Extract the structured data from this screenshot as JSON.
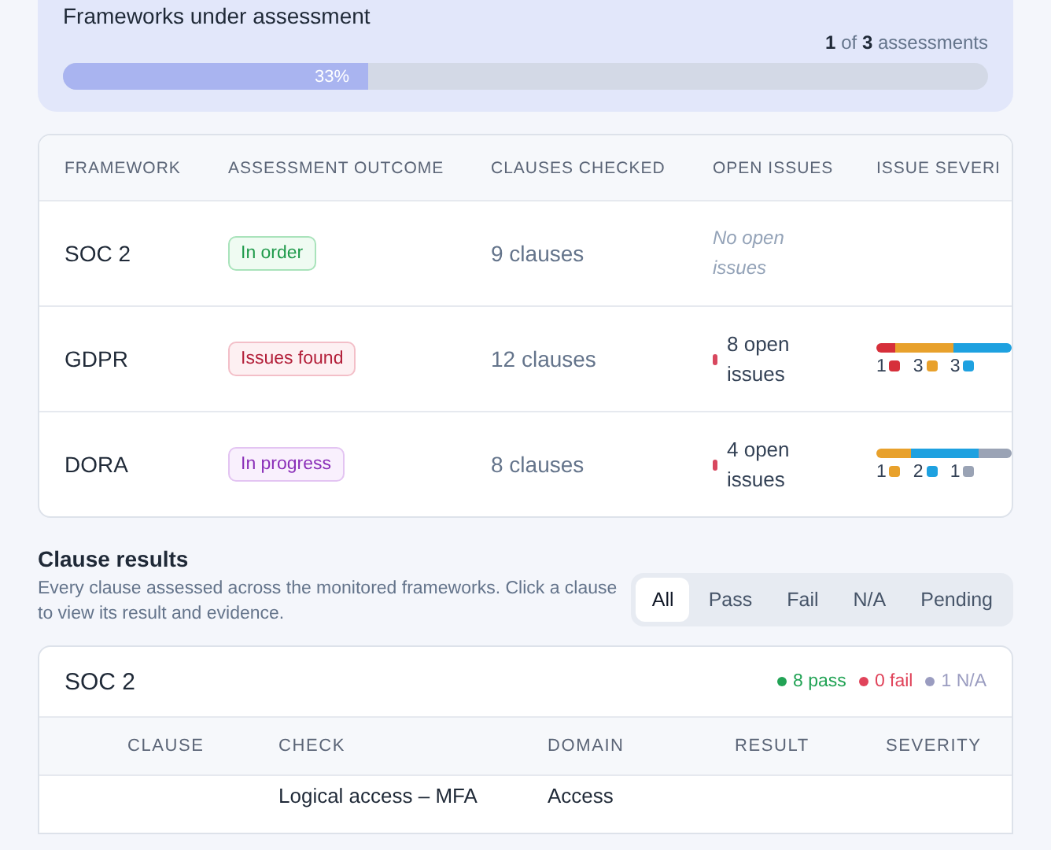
{
  "progress": {
    "title": "Frameworks under assessment",
    "done": "1",
    "of": "of",
    "total": "3",
    "unit": "assessments",
    "level": 0.33,
    "label": "33%"
  },
  "frameworks": {
    "columns": [
      "FRAMEWORK",
      "ASSESSMENT OUTCOME",
      "CLAUSES CHECKED",
      "OPEN ISSUES",
      "ISSUE SEVERI"
    ],
    "rows": [
      {
        "name": "SOC 2",
        "outcome": {
          "label": "In order",
          "kind": "ok"
        },
        "clauses": "9 clauses",
        "issues": "No open issues",
        "has_issues": false,
        "severity": []
      },
      {
        "name": "GDPR",
        "outcome": {
          "label": "Issues found",
          "kind": "fail"
        },
        "clauses": "12 clauses",
        "issues": "8 open issues",
        "has_issues": true,
        "severity": [
          {
            "count": "1",
            "color": "#d62f3a"
          },
          {
            "count": "3",
            "color": "#e8a12c"
          },
          {
            "count": "3",
            "color": "#1ea1e0"
          }
        ]
      },
      {
        "name": "DORA",
        "outcome": {
          "label": "In progress",
          "kind": "progress"
        },
        "clauses": "8 clauses",
        "issues": "4 open issues",
        "has_issues": true,
        "severity": [
          {
            "count": "1",
            "color": "#e8a12c"
          },
          {
            "count": "2",
            "color": "#1ea1e0"
          },
          {
            "count": "1",
            "color": "#9aa3b5"
          }
        ]
      }
    ]
  },
  "clause_results": {
    "title": "Clause results",
    "description": "Every clause assessed across the monitored frameworks. Click a clause to view its result and evidence.",
    "filters": [
      {
        "label": "All",
        "selected": true
      },
      {
        "label": "Pass",
        "selected": false
      },
      {
        "label": "Fail",
        "selected": false
      },
      {
        "label": "N/A",
        "selected": false
      },
      {
        "label": "Pending",
        "selected": false
      }
    ],
    "group": {
      "name": "SOC 2",
      "stats": [
        {
          "label": "8 pass",
          "color": "#22a355"
        },
        {
          "label": "0 fail",
          "color": "#e0435a"
        },
        {
          "label": "1 N/A",
          "color": "#9a9cc0"
        }
      ],
      "columns": [
        "CLAUSE",
        "CHECK",
        "DOMAIN",
        "RESULT",
        "SEVERITY"
      ],
      "rows": [
        {
          "check": "Logical access – MFA",
          "domain": "Access"
        }
      ]
    }
  }
}
